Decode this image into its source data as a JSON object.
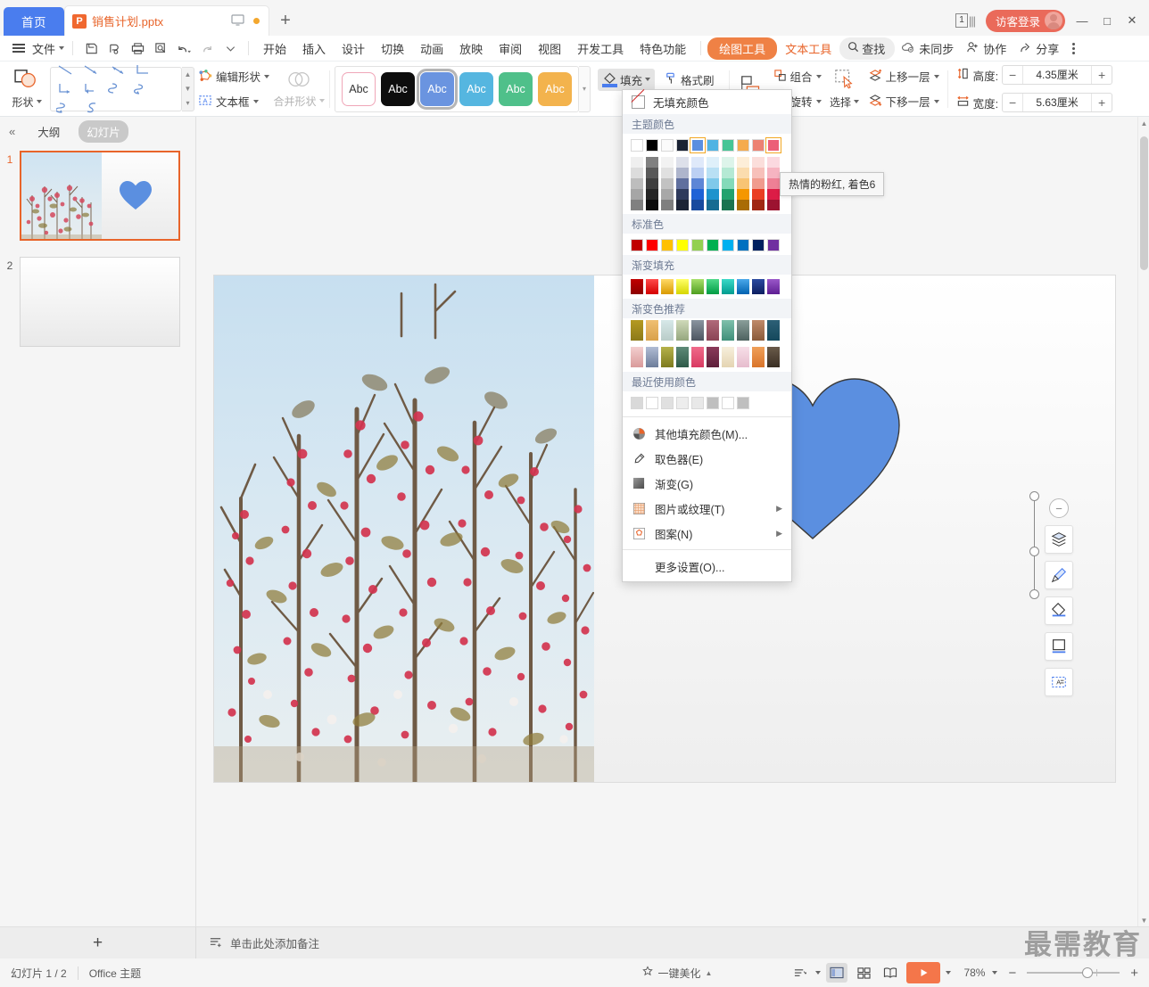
{
  "titlebar": {
    "home_tab": "首页",
    "doc_tab": {
      "name": "销售计划.pptx",
      "icon_letter": "P"
    },
    "new_tab": "+",
    "page_badge": "1",
    "login": "访客登录",
    "min": "—",
    "max": "□",
    "close": "✕"
  },
  "menubar": {
    "file": "文件",
    "tabs": [
      "开始",
      "插入",
      "设计",
      "切换",
      "动画",
      "放映",
      "审阅",
      "视图",
      "开发工具",
      "特色功能"
    ],
    "drawing_tools": "绘图工具",
    "text_tools": "文本工具",
    "find": "查找",
    "sync": "未同步",
    "collab": "协作",
    "share": "分享"
  },
  "ribbon": {
    "shape_label": "形状",
    "edit_shape": "编辑形状",
    "textbox": "文本框",
    "merge_shape": "合并形状",
    "fill": "填充",
    "format_painter": "格式刷",
    "group": "组合",
    "rotate": "旋转",
    "select": "选择",
    "bring_forward": "上移一层",
    "send_backward": "下移一层",
    "height_label": "高度:",
    "height_value": "4.35厘米",
    "width_label": "宽度:",
    "width_value": "5.63厘米",
    "style_swatches": [
      {
        "name": "white",
        "bg": "#ffffff",
        "border": "#f0a6b8",
        "text": "#333333"
      },
      {
        "name": "black",
        "bg": "#0d0d0d",
        "border": "#0d0d0d",
        "text": "#ffffff"
      },
      {
        "name": "blue",
        "bg": "#6a94e0",
        "border": "#6a94e0",
        "text": "#ffffff",
        "selected": true
      },
      {
        "name": "cyan",
        "bg": "#55b6e0",
        "border": "#55b6e0",
        "text": "#ffffff"
      },
      {
        "name": "green",
        "bg": "#4fc08a",
        "border": "#4fc08a",
        "text": "#ffffff"
      },
      {
        "name": "orange",
        "bg": "#f3b34d",
        "border": "#f3b34d",
        "text": "#ffffff"
      }
    ],
    "style_label": "Abc"
  },
  "fill_menu": {
    "no_fill": "无填充颜色",
    "theme_colors_header": "主题颜色",
    "standard_colors_header": "标准色",
    "gradient_fill_header": "渐变填充",
    "gradient_recommend_header": "渐变色推荐",
    "recent_colors_header": "最近使用颜色",
    "theme_base": [
      "#ffffff",
      "#000000",
      "#fbfbfb",
      "#1a2233",
      "#5b8fe0",
      "#4fb3e3",
      "#46c596",
      "#f5ab4e",
      "#ed8272",
      "#ec5f78"
    ],
    "theme_selected_indices": [
      4,
      9
    ],
    "theme_tints": [
      [
        "#efefef",
        "#dcdcdc",
        "#bdbdbd",
        "#a6a6a6",
        "#808080"
      ],
      [
        "#808080",
        "#595959",
        "#3f3f3f",
        "#262626",
        "#0d0d0d"
      ],
      [
        "#f2f2f2",
        "#e0e0e0",
        "#c2c2c2",
        "#a8a8a8",
        "#7f7f7f"
      ],
      [
        "#dde0ea",
        "#aeb5cc",
        "#5f6f9e",
        "#2e3a5c",
        "#1c2436"
      ],
      [
        "#dfe9fa",
        "#bcd0f3",
        "#5d86d6",
        "#1f62d6",
        "#174a9e"
      ],
      [
        "#dff0fa",
        "#b9e0f4",
        "#7fc9ea",
        "#1e93cd",
        "#176b92"
      ],
      [
        "#ddf4ea",
        "#b5e9d4",
        "#84dab9",
        "#23a26e",
        "#1b7350"
      ],
      [
        "#fdeed8",
        "#fbdcae",
        "#f8c474",
        "#f59700",
        "#a96c06"
      ],
      [
        "#fbdedb",
        "#f7c0ba",
        "#f09b8e",
        "#ea3e23",
        "#a02713"
      ],
      [
        "#fbd9e0",
        "#f6b4c1",
        "#ee8095",
        "#dc1c46",
        "#9c1330"
      ]
    ],
    "standard_colors": [
      "#c00000",
      "#ff0000",
      "#ffc000",
      "#ffff00",
      "#92d050",
      "#00b050",
      "#00b0f0",
      "#0070c0",
      "#002060",
      "#7030a0"
    ],
    "gradient_fill": [
      [
        "#c00000",
        "#8c0000"
      ],
      [
        "#ff4b4b",
        "#d40000"
      ],
      [
        "#ffd966",
        "#d99a00"
      ],
      [
        "#ffff66",
        "#d6d600"
      ],
      [
        "#a8e06a",
        "#4f9e20"
      ],
      [
        "#4fd98a",
        "#009c44"
      ],
      [
        "#3ad9c8",
        "#009c8f"
      ],
      [
        "#4aa8ea",
        "#0062b0"
      ],
      [
        "#2b4aa0",
        "#0d1e60"
      ],
      [
        "#9a57c9",
        "#5e1f93"
      ]
    ],
    "gradient_recommend_row1": [
      [
        "#b59a22",
        "#8c7a18"
      ],
      [
        "#f0c072",
        "#d9a14a"
      ],
      [
        "#d6e8e8",
        "#b9ccc8"
      ],
      [
        "#cfd9b9",
        "#95a77e"
      ],
      [
        "#8a94a0",
        "#4d5560"
      ],
      [
        "#b06a7a",
        "#8a4455"
      ],
      [
        "#7fc0ac",
        "#3f8f79"
      ],
      [
        "#8a9e9a",
        "#4e625f"
      ],
      [
        "#c08a6a",
        "#8a5a3a"
      ],
      [
        "#2d6076",
        "#14485c"
      ]
    ],
    "gradient_recommend_row2": [
      [
        "#f3cfcf",
        "#d99a9a"
      ],
      [
        "#b0bcd4",
        "#6d7d9a"
      ],
      [
        "#b5b24a",
        "#7d7a1e"
      ],
      [
        "#5e8a78",
        "#2e5a48"
      ],
      [
        "#f06a8a",
        "#d93a62"
      ],
      [
        "#8a3a5a",
        "#5e1f3a"
      ],
      [
        "#f7efdc",
        "#e4d4b2"
      ],
      [
        "#f7dfe8",
        "#e6bccd"
      ],
      [
        "#f0a05a",
        "#d9742a"
      ],
      [
        "#6a5a4a",
        "#3a2f24"
      ]
    ],
    "recent_colors": [
      "#d9d9d9",
      "#ffffff",
      "#e0e0e0",
      "#ededed",
      "#e8e8e8",
      "#bfbfbf",
      "#ffffff",
      "#bfbfbf"
    ],
    "items": [
      {
        "label": "其他填充颜色(M)...",
        "icon": "color-wheel-icon",
        "submenu": false
      },
      {
        "label": "取色器(E)",
        "icon": "eyedropper-icon",
        "submenu": false
      },
      {
        "label": "渐变(G)",
        "icon": "gradient-icon",
        "submenu": false
      },
      {
        "label": "图片或纹理(T)",
        "icon": "texture-icon",
        "submenu": true
      },
      {
        "label": "图案(N)",
        "icon": "pattern-icon",
        "submenu": true
      },
      {
        "label": "更多设置(O)...",
        "icon": "none",
        "submenu": false
      }
    ]
  },
  "tooltip": {
    "text": "热情的粉红, 着色6"
  },
  "slide_panel": {
    "outline_tab": "大纲",
    "slides_tab": "幻灯片",
    "collapse_icon": "«",
    "thumbs": [
      {
        "number": "1",
        "selected": true
      },
      {
        "number": "2",
        "selected": false
      }
    ]
  },
  "notes": {
    "add_slide": "+",
    "placeholder": "单击此处添加备注"
  },
  "statusbar": {
    "slide_count": "幻灯片 1 / 2",
    "theme": "Office 主题",
    "beautify": "一键美化",
    "zoom": "78%",
    "zoom_out": "−",
    "zoom_in": "+"
  },
  "watermark": {
    "text": "最需教育"
  }
}
